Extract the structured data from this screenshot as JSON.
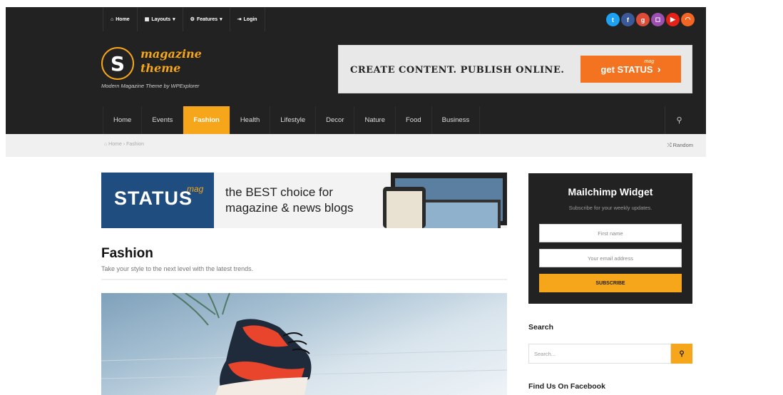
{
  "topbar": {
    "items": [
      {
        "icon": "home-icon",
        "glyph": "⌂",
        "label": "Home"
      },
      {
        "icon": "grid-icon",
        "glyph": "▦",
        "label": "Layouts",
        "caret": "▾"
      },
      {
        "icon": "gear-icon",
        "glyph": "⚙",
        "label": "Features",
        "caret": "▾"
      },
      {
        "icon": "login-icon",
        "glyph": "⇥",
        "label": "Login"
      }
    ],
    "social": [
      {
        "name": "twitter",
        "glyph": "t",
        "color": "#1da1f2"
      },
      {
        "name": "facebook",
        "glyph": "f",
        "color": "#3b5998"
      },
      {
        "name": "google-plus",
        "glyph": "g",
        "color": "#dd4b39"
      },
      {
        "name": "instagram",
        "glyph": "◻",
        "color": "#9b4fb0"
      },
      {
        "name": "youtube",
        "glyph": "▶",
        "color": "#e62117"
      },
      {
        "name": "rss",
        "glyph": "◠",
        "color": "#f26522"
      }
    ]
  },
  "brand": {
    "logo_letter": "S",
    "name_line1": "magazine",
    "name_line2": "theme",
    "tagline": "Modern Magazine Theme by WPExplorer",
    "accent": "#f6a61a"
  },
  "header_ad": {
    "text": "CREATE CONTENT. PUBLISH ONLINE.",
    "button_label": "get STATUS",
    "button_sup": "mag",
    "button_arrow": "›"
  },
  "mainnav": {
    "items": [
      "Home",
      "Events",
      "Fashion",
      "Health",
      "Lifestyle",
      "Decor",
      "Nature",
      "Food",
      "Business"
    ],
    "active": "Fashion",
    "search_glyph": "⚲"
  },
  "breadcrumb": {
    "home": "⌂ Home",
    "separator": "›",
    "current": "Fashion",
    "random": "⤭ Random"
  },
  "promo_banner": {
    "brand": "STATUS",
    "brand_sup": "mag",
    "line1": "the BEST choice for",
    "line2": "magazine & news blogs"
  },
  "archive": {
    "title": "Fashion",
    "description": "Take your style to the next level with the latest trends."
  },
  "mailchimp": {
    "title": "Mailchimp Widget",
    "subtitle": "Subscribe for your weekly updates.",
    "first_name_placeholder": "First name",
    "email_placeholder": "Your email address",
    "button_label": "SUBSCRIBE"
  },
  "search_widget": {
    "heading": "Search",
    "placeholder": "Search...",
    "button_glyph": "⚲"
  },
  "facebook_widget": {
    "heading": "Find Us On Facebook"
  }
}
